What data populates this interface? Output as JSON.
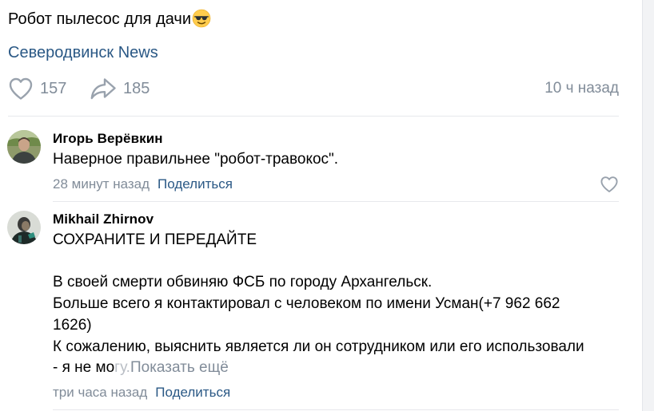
{
  "post": {
    "text": "Робот пылесос для дачи",
    "emoji_icon": "smiling-face-with-sunglasses-icon",
    "source": "Северодвинск News",
    "likes": "157",
    "shares": "185",
    "time": "10 ч назад"
  },
  "comments": [
    {
      "author": "Игорь Верёвкин",
      "lines": [
        "Наверное правильнее \"робот-травокос\"."
      ],
      "time": "28 минут назад",
      "share_label": "Поделиться"
    },
    {
      "author": "Mikhail Zhirnov",
      "lines": [
        "СОХРАНИТЕ И ПЕРЕДАЙТЕ",
        "",
        "В своей смерти обвиняю ФСБ по городу Архангельск.",
        "Больше всего я контактировал с человеком по имени Усман(+7 962 662",
        "1626)",
        "К сожалению, выяснить является ли он сотрудником или его использовали"
      ],
      "last_line_visible": "- я не мо",
      "last_line_faded": "гу.",
      "show_more": "Показать ещё",
      "time": "три часа назад",
      "share_label": "Поделиться"
    }
  ],
  "colors": {
    "link": "#2a5885",
    "secondary": "#818c99",
    "divider": "#e7e8ec"
  }
}
